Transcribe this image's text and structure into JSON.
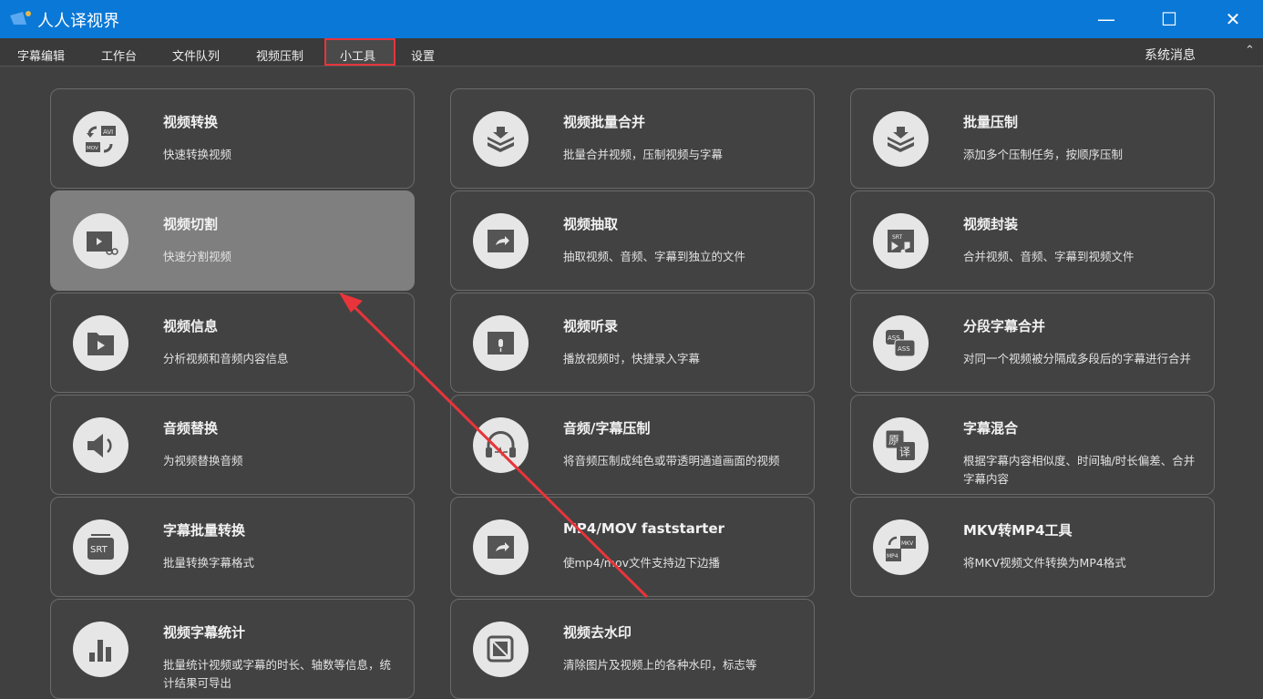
{
  "window": {
    "title": "人人译视界",
    "minimize": "—",
    "maximize": "☐",
    "close": "✕"
  },
  "menu": {
    "items": [
      "字幕编辑",
      "工作台",
      "文件队列",
      "视频压制",
      "小工具",
      "设置"
    ],
    "active": "小工具",
    "system_messages": "系统消息",
    "collapse": "⌃"
  },
  "colors": {
    "titlebar": "#0a78d6",
    "highlight": "#e8343a",
    "arrow": "#e8343a"
  },
  "tools": [
    {
      "title": "视频转换",
      "desc": "快速转换视频",
      "icon": "convert-icon"
    },
    {
      "title": "视频批量合并",
      "desc": "批量合并视频，压制视频与字幕",
      "icon": "layers-icon"
    },
    {
      "title": "批量压制",
      "desc": "添加多个压制任务，按顺序压制",
      "icon": "layers-icon"
    },
    {
      "title": "视频切割",
      "desc": "快速分割视频",
      "icon": "video-cut-icon",
      "hovered": true
    },
    {
      "title": "视频抽取",
      "desc": "抽取视频、音频、字幕到独立的文件",
      "icon": "video-extract-icon"
    },
    {
      "title": "视频封装",
      "desc": "合并视频、音频、字幕到视频文件",
      "icon": "package-icon"
    },
    {
      "title": "视频信息",
      "desc": "分析视频和音频内容信息",
      "icon": "video-info-icon"
    },
    {
      "title": "视频听录",
      "desc": "播放视频时，快捷录入字幕",
      "icon": "mic-icon"
    },
    {
      "title": "分段字幕合并",
      "desc": "对同一个视频被分隔成多段后的字幕进行合并",
      "icon": "ass-merge-icon"
    },
    {
      "title": "音频替换",
      "desc": "为视频替换音频",
      "icon": "speaker-icon"
    },
    {
      "title": "音频/字幕压制",
      "desc": "将音频压制成纯色或带透明通道画面的视频",
      "icon": "headphones-icon"
    },
    {
      "title": "字幕混合",
      "desc": "根据字幕内容相似度、时间轴/时长偏差、合并字幕内容",
      "icon": "translate-icon"
    },
    {
      "title": "字幕批量转换",
      "desc": "批量转换字幕格式",
      "icon": "srt-icon"
    },
    {
      "title": "MP4/MOV faststarter",
      "desc": "使mp4/mov文件支持边下边播",
      "icon": "video-extract-icon"
    },
    {
      "title": "MKV转MP4工具",
      "desc": "将MKV视频文件转换为MP4格式",
      "icon": "mkv-mp4-icon"
    },
    {
      "title": "视频字幕统计",
      "desc": "批量统计视频或字幕的时长、轴数等信息，统计结果可导出",
      "icon": "bar-chart-icon"
    },
    {
      "title": "视频去水印",
      "desc": "清除图片及视频上的各种水印，标志等",
      "icon": "watermark-icon"
    }
  ]
}
